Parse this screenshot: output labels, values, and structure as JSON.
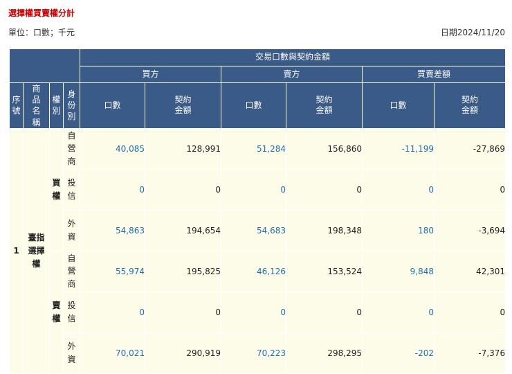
{
  "title": "選擇權買賣權分計",
  "unit": "單位：口數；千元",
  "date": "日期2024/11/20",
  "header": {
    "group": "交易口數與契約金額",
    "seq": "序號",
    "product": "商品名稱",
    "right": "權別",
    "identity": "身份別",
    "buy": "買方",
    "sell": "賣方",
    "diff": "買賣差額",
    "lots": "口數",
    "amount": "契約金額"
  },
  "body": {
    "seq": "1",
    "product": "臺指選擇權",
    "groups": [
      {
        "right": "買權",
        "rows": [
          {
            "identity": "自營商",
            "buy_lots": "40,085",
            "buy_amount": "128,991",
            "sell_lots": "51,284",
            "sell_amount": "156,860",
            "diff_lots": "-11,199",
            "diff_amount": "-27,869"
          },
          {
            "identity": "投信",
            "buy_lots": "0",
            "buy_amount": "0",
            "sell_lots": "0",
            "sell_amount": "0",
            "diff_lots": "0",
            "diff_amount": "0"
          },
          {
            "identity": "外資",
            "buy_lots": "54,863",
            "buy_amount": "194,654",
            "sell_lots": "54,683",
            "sell_amount": "198,348",
            "diff_lots": "180",
            "diff_amount": "-3,694"
          }
        ]
      },
      {
        "right": "賣權",
        "rows": [
          {
            "identity": "自營商",
            "buy_lots": "55,974",
            "buy_amount": "195,825",
            "sell_lots": "46,126",
            "sell_amount": "153,524",
            "diff_lots": "9,848",
            "diff_amount": "42,301"
          },
          {
            "identity": "投信",
            "buy_lots": "0",
            "buy_amount": "0",
            "sell_lots": "0",
            "sell_amount": "0",
            "diff_lots": "0",
            "diff_amount": "0"
          },
          {
            "identity": "外資",
            "buy_lots": "70,021",
            "buy_amount": "290,919",
            "sell_lots": "70,223",
            "sell_amount": "298,295",
            "diff_lots": "-202",
            "diff_amount": "-7,376"
          }
        ]
      }
    ]
  },
  "colors": {
    "header_bg": "#3a5a87",
    "cell_bg": "#fcfce8",
    "title": "#cc0000",
    "link": "#1f6fb2"
  }
}
